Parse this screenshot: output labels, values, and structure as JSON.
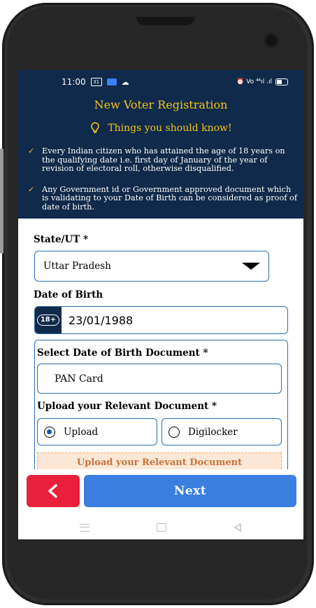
{
  "status_bar": {
    "time": "11:00",
    "sim_badge": "31",
    "right_text": "⏰ Vo ⁴⁶ıl .ıl"
  },
  "header": {
    "title": "New Voter Registration",
    "subtitle": "Things you should know!",
    "tips": [
      "Every Indian citizen who has attained the age of 18 years on the qualifying date i.e. first day of January of the year of revision of electoral roll, otherwise disqualified.",
      "Any Government id or Government approved document which is validating to your Date of Birth can be considered as proof of date of birth."
    ]
  },
  "form": {
    "state_label": "State/UT *",
    "state_value": "Uttar Pradesh",
    "dob_label": "Date of Birth",
    "age_badge": "18+",
    "dob_value": "23/01/1988",
    "doc_label": "Select Date of Birth Document *",
    "doc_value": "PAN Card",
    "upload_label": "Upload your Relevant Document *",
    "option_upload": "Upload",
    "option_digilocker": "Digilocker",
    "selected_option": "Upload",
    "upload_area_text": "Upload your Relevant Document"
  },
  "actions": {
    "next_label": "Next"
  },
  "colors": {
    "header_bg": "#0f2a4a",
    "accent_yellow": "#f5c518",
    "border_blue": "#2a6fb0",
    "back_red": "#e8203c",
    "next_blue": "#3a7ee0"
  }
}
